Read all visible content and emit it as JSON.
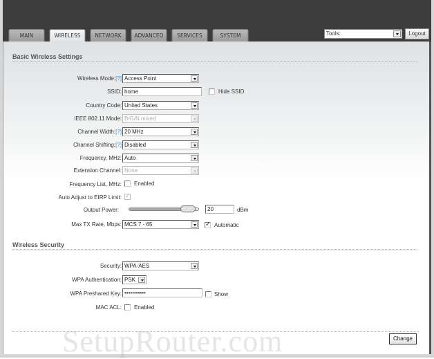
{
  "nav": {
    "tabs": [
      {
        "label": "MAIN",
        "active": false
      },
      {
        "label": "WIRELESS",
        "active": true
      },
      {
        "label": "NETWORK",
        "active": false
      },
      {
        "label": "ADVANCED",
        "active": false
      },
      {
        "label": "SERVICES",
        "active": false
      },
      {
        "label": "SYSTEM",
        "active": false
      }
    ],
    "tools_select": "Tools:",
    "logout_label": "Logout"
  },
  "basic": {
    "title": "Basic Wireless Settings",
    "help_marker": "[?]",
    "wireless_mode": {
      "label": "Wireless Mode:",
      "value": "Access Point"
    },
    "ssid": {
      "label": "SSID:",
      "value": "home",
      "hide_label": "Hide SSID",
      "hide_checked": false
    },
    "country_code": {
      "label": "Country Code:",
      "value": "United States"
    },
    "ieee_mode": {
      "label": "IEEE 802.11 Mode:",
      "value": "B/G/N mixed",
      "disabled": true
    },
    "channel_width": {
      "label": "Channel Width:",
      "value": "20 MHz"
    },
    "channel_shifting": {
      "label": "Channel Shifting:",
      "value": "Disabled"
    },
    "frequency": {
      "label": "Frequency, MHz:",
      "value": "Auto"
    },
    "extension_channel": {
      "label": "Extension Channel:",
      "value": "None",
      "disabled": true
    },
    "frequency_list": {
      "label": "Frequency List, MHz:",
      "checkbox_label": "Enabled",
      "checked": false
    },
    "auto_adjust": {
      "label": "Auto Adjust to EIRP Limit:",
      "checked": true,
      "disabled": true
    },
    "output_power": {
      "label": "Output Power:",
      "value": "20",
      "unit": "dBm",
      "slider_fraction": 0.85
    },
    "max_tx_rate": {
      "label": "Max TX Rate, Mbps:",
      "value": "MCS 7 - 65",
      "automatic_label": "Automatic",
      "automatic_checked": true
    }
  },
  "security": {
    "title": "Wireless Security",
    "security": {
      "label": "Security:",
      "value": "WPA-AES"
    },
    "wpa_auth": {
      "label": "WPA Authentication:",
      "value": "PSK"
    },
    "wpa_key": {
      "label": "WPA Preshared Key:",
      "value": "•••••••••••",
      "show_label": "Show",
      "show_checked": false
    },
    "mac_acl": {
      "label": "MAC ACL:",
      "checkbox_label": "Enabled",
      "checked": false
    }
  },
  "footer": {
    "change_label": "Change",
    "watermark": "SetupRouter.com"
  }
}
